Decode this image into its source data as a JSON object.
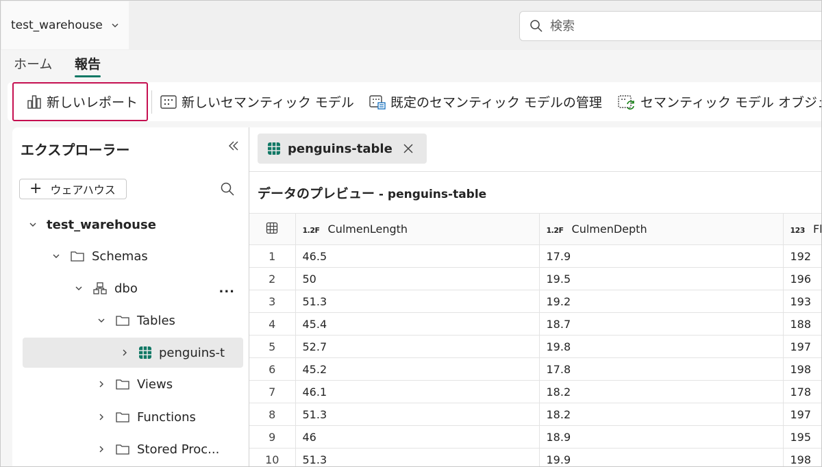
{
  "workspace": {
    "name": "test_warehouse"
  },
  "search": {
    "placeholder": "検索"
  },
  "tabs": {
    "home": "ホーム",
    "report": "報告"
  },
  "ribbon": {
    "new_report": "新しいレポート",
    "new_semantic_model": "新しいセマンティック モデル",
    "manage_default_model": "既定のセマンティック モデルの管理",
    "semantic_model_objects": "セマンティック モデル オブジェクト"
  },
  "explorer": {
    "title": "エクスプローラー",
    "add_button": "ウェアハウス",
    "tree": {
      "warehouse": "test_warehouse",
      "schemas": "Schemas",
      "dbo": "dbo",
      "tables": "Tables",
      "penguins": "penguins-t",
      "views": "Views",
      "functions": "Functions",
      "stored_procs": "Stored Proc..."
    },
    "more_label": "..."
  },
  "main": {
    "tab_label": "penguins-table",
    "preview_title": "データのプレビュー",
    "preview_sub": " - penguins-table",
    "columns": [
      {
        "type": "1.2F",
        "name": "CulmenLength"
      },
      {
        "type": "1.2F",
        "name": "CulmenDepth"
      },
      {
        "type": "123",
        "name": "FlipperLength"
      }
    ],
    "rows": [
      [
        "1",
        "46.5",
        "17.9",
        "192"
      ],
      [
        "2",
        "50",
        "19.5",
        "196"
      ],
      [
        "3",
        "51.3",
        "19.2",
        "193"
      ],
      [
        "4",
        "45.4",
        "18.7",
        "188"
      ],
      [
        "5",
        "52.7",
        "19.8",
        "197"
      ],
      [
        "6",
        "45.2",
        "17.8",
        "198"
      ],
      [
        "7",
        "46.1",
        "18.2",
        "178"
      ],
      [
        "8",
        "51.3",
        "18.2",
        "197"
      ],
      [
        "9",
        "46",
        "18.9",
        "195"
      ],
      [
        "10",
        "51.3",
        "19.9",
        "198"
      ]
    ]
  },
  "colors": {
    "accent": "#117865",
    "highlight_border": "#c50f50",
    "table_icon": "#117865"
  }
}
